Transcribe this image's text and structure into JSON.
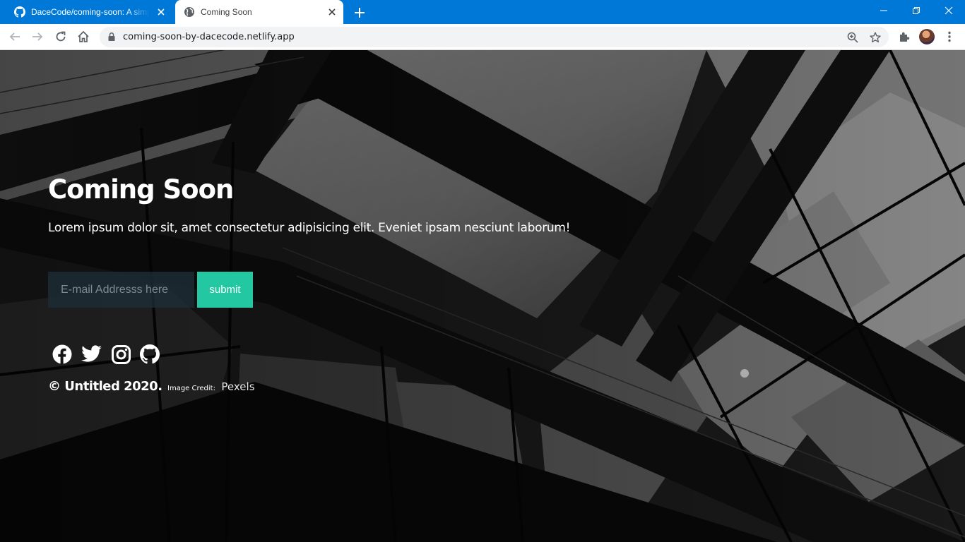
{
  "browser": {
    "tabs": [
      {
        "title": "DaceCode/coming-soon: A simple coming soon page",
        "icon": "github-icon",
        "active": false
      },
      {
        "title": "Coming Soon",
        "icon": "globe-icon",
        "active": true
      }
    ],
    "url": "coming-soon-by-dacecode.netlify.app",
    "accent_color": "#0078d7"
  },
  "page": {
    "title": "Coming Soon",
    "subtitle": "Lorem ipsum dolor sit, amet consectetur adipisicing elit. Eveniet ipsam nesciunt laborum!",
    "email_placeholder": "E-mail Addresss here",
    "submit_label": "submit",
    "submit_color": "#23c7a2",
    "social": [
      "facebook-icon",
      "twitter-icon",
      "instagram-icon",
      "github-icon"
    ],
    "footer": {
      "copyright": "© Untitled 2020.",
      "credit_label": "Image Credit:",
      "credit_link": "Pexels"
    }
  }
}
